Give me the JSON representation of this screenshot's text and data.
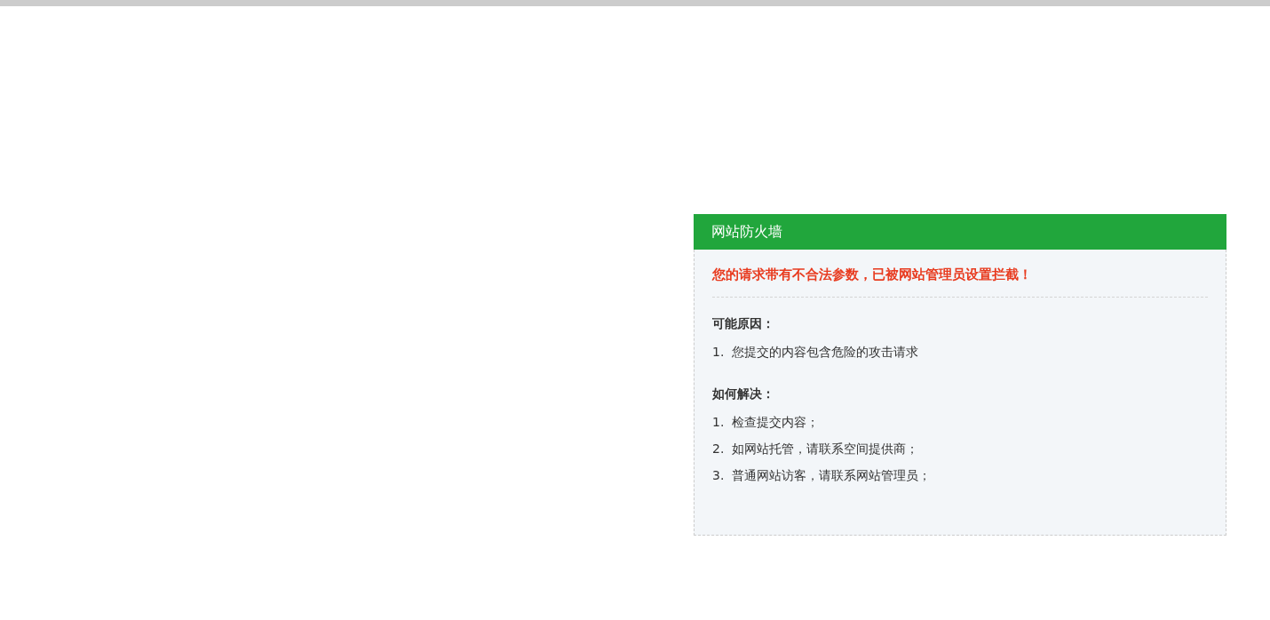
{
  "panel": {
    "title": "网站防火墙",
    "message": "您的请求带有不合法参数，已被网站管理员设置拦截！",
    "sections": [
      {
        "heading": "可能原因：",
        "items": [
          {
            "number": "1.",
            "text": "您提交的内容包含危险的攻击请求"
          }
        ]
      },
      {
        "heading": "如何解决：",
        "items": [
          {
            "number": "1.",
            "text": "检查提交内容；"
          },
          {
            "number": "2.",
            "text": "如网站托管，请联系空间提供商；"
          },
          {
            "number": "3.",
            "text": "普通网站访客，请联系网站管理员；"
          }
        ]
      }
    ]
  }
}
